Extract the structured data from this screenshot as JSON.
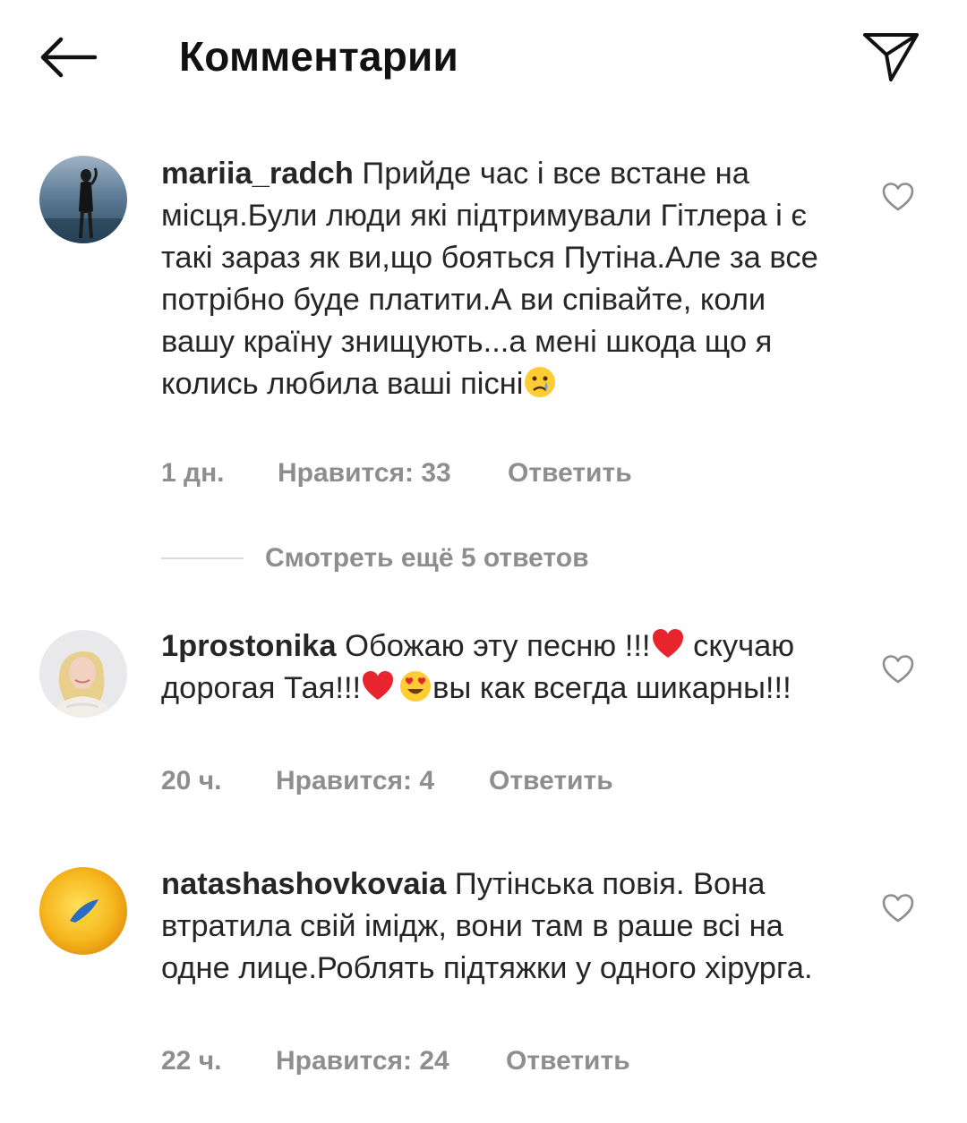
{
  "header": {
    "title": "Комментарии",
    "back_icon": "arrow-left-icon",
    "send_icon": "paper-plane-icon"
  },
  "comments": [
    {
      "username": "mariia_radch",
      "text": "Прийде час і все встане на місця.Були люди які підтримували Гітлера і є такі зараз  як ви,що бояться Путіна.Але за все потрібно буде платити.А ви співайте, коли вашу країну знищують...а мені шкода що я колись любила ваші пісні",
      "time": "1 дн.",
      "likes": "Нравится: 33",
      "reply": "Ответить"
    },
    {
      "username": "1prostonika",
      "text_1": "Обожаю эту песню !!!",
      "text_2": "скучаю дорогая Тая!!!",
      "text_3": "вы как всегда шикарны!!!",
      "time": "20 ч.",
      "likes": "Нравится: 4",
      "reply": "Ответить"
    },
    {
      "username": "natashashovkovaia",
      "text": "Путінська повія. Вона втратила свій імідж, вони там в раше всі на одне лице.Роблять підтяжки у одного хірурга.",
      "time": "22 ч.",
      "likes": "Нравится: 24",
      "reply": "Ответить"
    }
  ],
  "view_replies": "Смотреть ещё 5 ответов",
  "colors": {
    "text": "#262626",
    "secondary": "#8e8e8e",
    "heart": "#e8252f",
    "divider": "#dbdbdb"
  }
}
